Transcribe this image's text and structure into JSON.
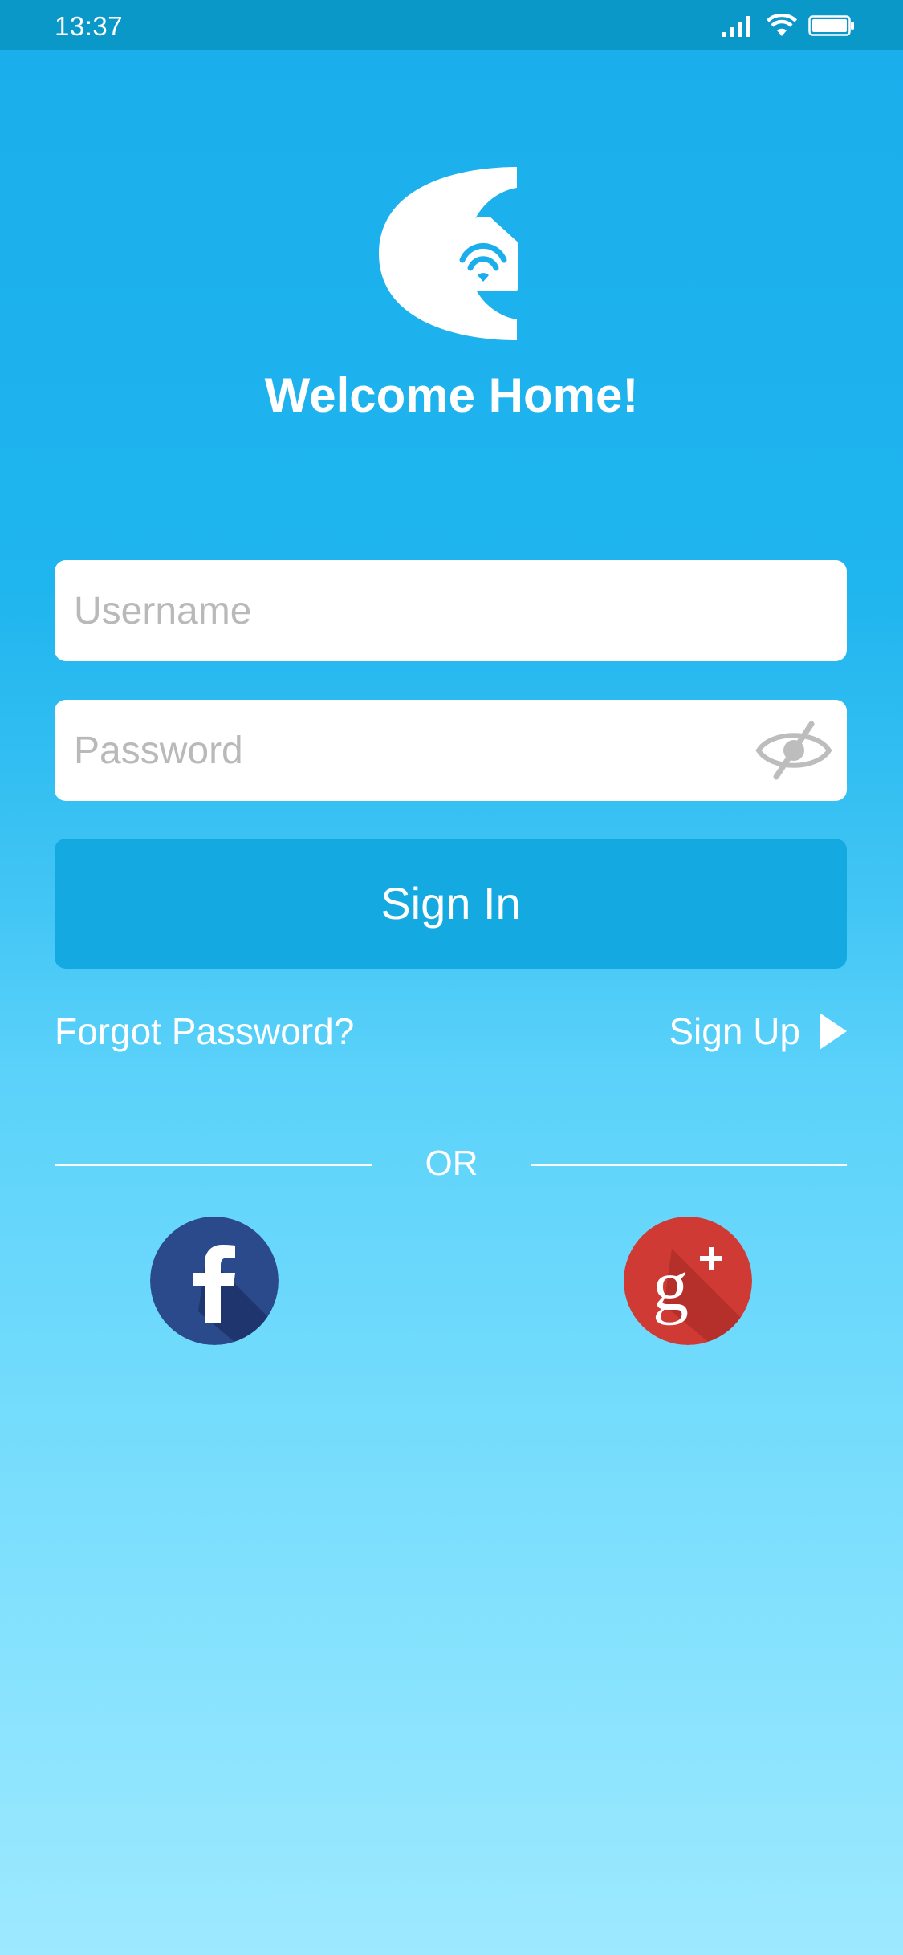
{
  "status_bar": {
    "time": "13:37",
    "icons": [
      "signal-icon",
      "wifi-icon",
      "battery-icon"
    ]
  },
  "header": {
    "logo_icon": "smart-home-logo-icon",
    "welcome": "Welcome Home!"
  },
  "form": {
    "username_placeholder": "Username",
    "username_value": "",
    "password_placeholder": "Password",
    "password_value": "",
    "password_toggle_icon": "eye-off-icon",
    "sign_in_label": "Sign In",
    "forgot_label": "Forgot Password?",
    "sign_up_label": "Sign Up"
  },
  "social": {
    "or_label": "OR",
    "facebook_icon": "facebook-icon",
    "google_icon": "google-plus-icon"
  },
  "colors": {
    "status_bar": "#0a98c9",
    "background_top": "#1aaeec",
    "background_bottom": "#9de9ff",
    "button": "#14a9e0",
    "facebook": "#2b4a8b",
    "google": "#cf3a35"
  }
}
